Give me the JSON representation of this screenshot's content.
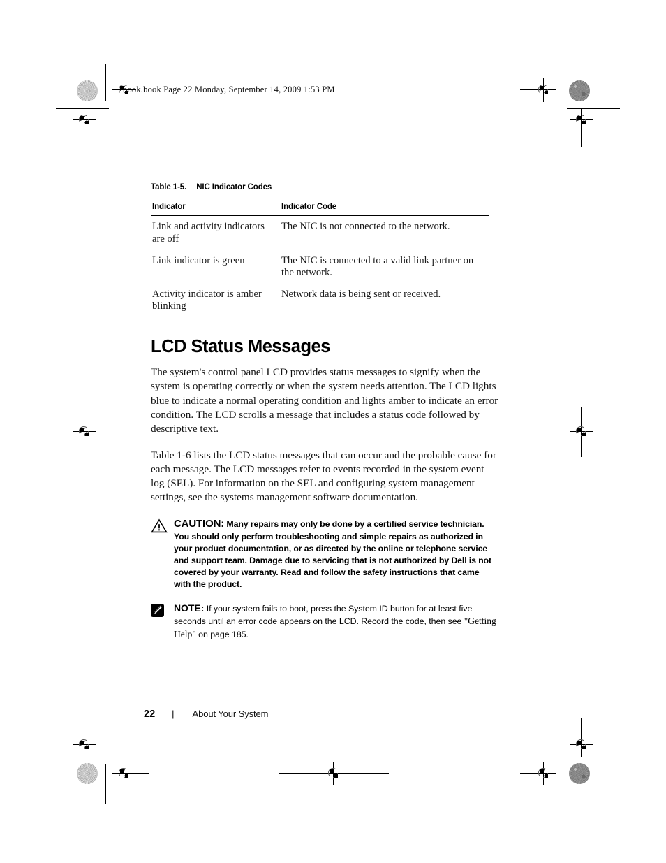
{
  "running_head": "book.book  Page 22  Monday, September 14, 2009  1:53 PM",
  "table": {
    "caption_number": "Table 1-5.",
    "caption_title": "NIC Indicator Codes",
    "columns": [
      "Indicator",
      "Indicator Code"
    ],
    "rows": [
      [
        "Link and activity indicators are off",
        "The NIC is not connected to the network."
      ],
      [
        "Link indicator is green",
        "The NIC is connected to a valid link partner on the network."
      ],
      [
        "Activity indicator is amber blinking",
        "Network data is being sent or received."
      ]
    ]
  },
  "section": {
    "title": "LCD Status Messages",
    "paragraphs": [
      "The system's control panel LCD provides status messages to signify when the system is operating correctly or when the system needs attention. The LCD lights blue to indicate a normal operating condition and lights amber to indicate an error condition. The LCD scrolls a message that includes a status code followed by descriptive text.",
      "Table 1-6 lists the LCD status messages that can occur and the probable cause for each message. The LCD messages refer to events recorded in the system event log (SEL). For information on the SEL and configuring system management settings, see the systems management software documentation."
    ]
  },
  "caution": {
    "keyword": "CAUTION:",
    "text": "Many repairs may only be done by a certified service technician. You should only perform troubleshooting and simple repairs as authorized in your product documentation, or as directed by the online or telephone service and support team. Damage due to servicing that is not authorized by Dell is not covered by your warranty. Read and follow the safety instructions that came with the product."
  },
  "note": {
    "keyword": "NOTE:",
    "text_before": "If your system fails to boot, press the System ID button for at least five seconds until an error code appears on the LCD. Record the code, then see",
    "xref": "\"Getting Help\"",
    "text_after": "on page 185."
  },
  "footer": {
    "page_number": "22",
    "separator": "|",
    "chapter": "About Your System"
  },
  "colors": {
    "text": "#000000",
    "page_background": "#ffffff",
    "rule": "#000000"
  }
}
